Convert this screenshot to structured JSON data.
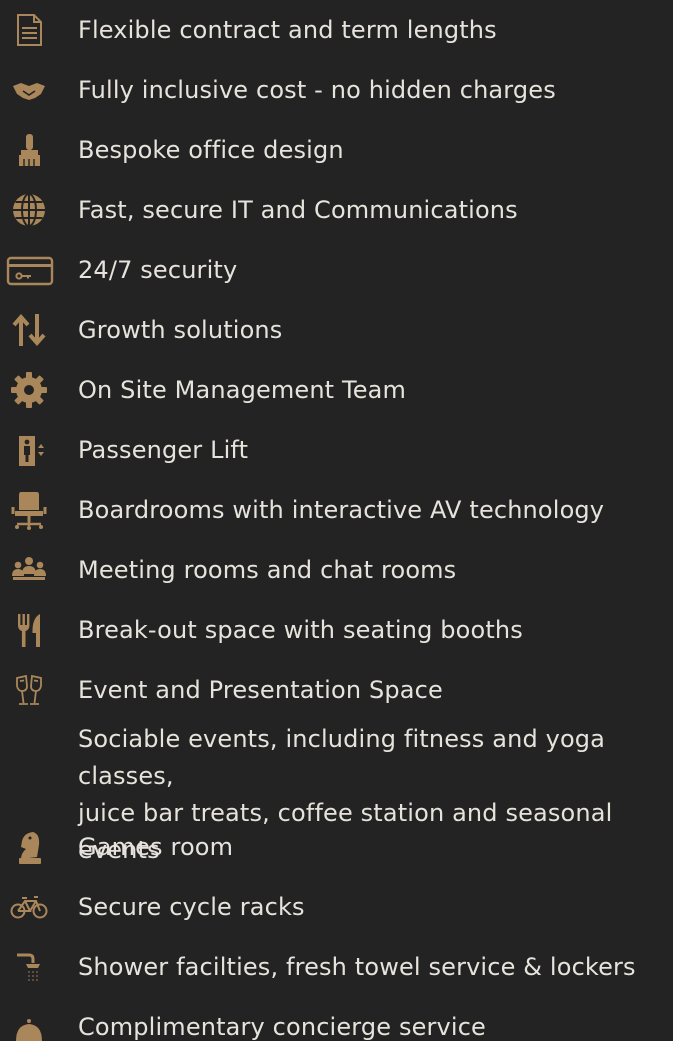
{
  "accent_color": "#a9875a",
  "background_color": "#232323",
  "text_color": "#e6e3dc",
  "amenities": [
    {
      "label": "Flexible contract and term lengths",
      "icon": "document-icon"
    },
    {
      "label": "Fully inclusive cost - no hidden charges",
      "icon": "handshake-icon"
    },
    {
      "label": "Bespoke office design",
      "icon": "paint-brush-icon"
    },
    {
      "label": "Fast, secure IT and Communications",
      "icon": "globe-icon"
    },
    {
      "label": "24/7 security",
      "icon": "key-card-icon"
    },
    {
      "label": "Growth solutions",
      "icon": "up-down-arrows-icon"
    },
    {
      "label": "On Site Management Team",
      "icon": "gear-icon"
    },
    {
      "label": "Passenger Lift",
      "icon": "elevator-icon"
    },
    {
      "label": "Boardrooms with interactive AV technology",
      "icon": "office-chair-icon"
    },
    {
      "label": "Meeting rooms and chat rooms",
      "icon": "people-group-icon"
    },
    {
      "label": "Break-out space with seating booths",
      "icon": "fork-knife-icon"
    },
    {
      "label": "Event and Presentation Space",
      "icon": "champagne-glasses-icon"
    },
    {
      "label": "Sociable events, including fitness and yoga classes,\njuice bar treats, coffee station and seasonal events",
      "icon": ""
    },
    {
      "label": "Games room",
      "icon": "chess-knight-icon"
    },
    {
      "label": "Secure cycle racks",
      "icon": "bicycle-icon"
    },
    {
      "label": "Shower facilties, fresh towel service & lockers",
      "icon": "shower-icon"
    },
    {
      "label": "Complimentary concierge service",
      "icon": "concierge-bell-icon"
    }
  ]
}
